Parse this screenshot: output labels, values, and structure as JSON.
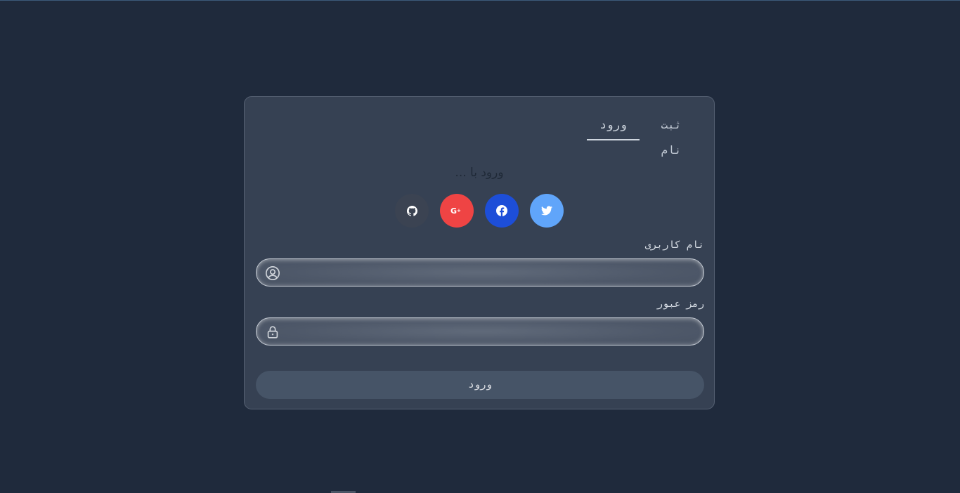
{
  "tabs": {
    "login": "ورود",
    "register": "ثبت نام"
  },
  "social": {
    "title": "ورود با ...",
    "buttons": [
      {
        "name": "twitter",
        "icon": "twitter-icon",
        "color": "#60a5fa"
      },
      {
        "name": "facebook",
        "icon": "facebook-icon",
        "color": "#1d4ed8"
      },
      {
        "name": "google-plus",
        "icon": "google-plus-icon",
        "color": "#ef4444"
      },
      {
        "name": "github",
        "icon": "github-icon",
        "color": "#3b4352"
      }
    ]
  },
  "form": {
    "username_label": "نام کاربری",
    "username_value": "",
    "password_label": "رمز عبور",
    "password_value": "",
    "submit_label": "ورود"
  },
  "colors": {
    "background": "#1f2a3c",
    "card": "#364153"
  }
}
